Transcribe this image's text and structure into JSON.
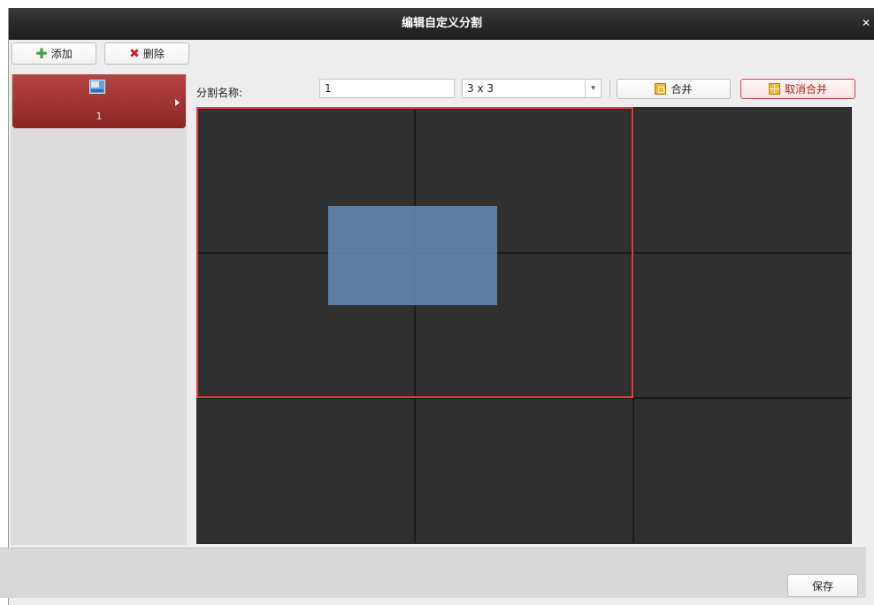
{
  "dialog": {
    "title": "编辑自定义分割",
    "close_icon": "close-icon"
  },
  "toolbar": {
    "add_label": "添加",
    "add_icon": "plus-icon",
    "delete_label": "删除",
    "delete_icon": "x-icon"
  },
  "layouts": [
    {
      "label": "1",
      "icon": "layout-thumbnail-icon",
      "selected": true
    }
  ],
  "editor": {
    "name_label": "分割名称:",
    "name_value": "1",
    "layout_select_value": "3 x 3",
    "merge_label": "合并",
    "unmerge_label": "取消合并"
  },
  "grid": {
    "rows": 3,
    "cols": 3,
    "merged_region": {
      "row_start": 1,
      "col_start": 1,
      "row_span": 2,
      "col_span": 2
    },
    "colors": {
      "cell": "#303030",
      "line": "#1b1b1b",
      "merge_border": "#d9413f",
      "selection": "#648cb4"
    }
  },
  "footer": {
    "save_label": "保存"
  },
  "colors": {
    "titlebar": "#262626",
    "selected_item": "#a33434",
    "background": "#ededed"
  }
}
